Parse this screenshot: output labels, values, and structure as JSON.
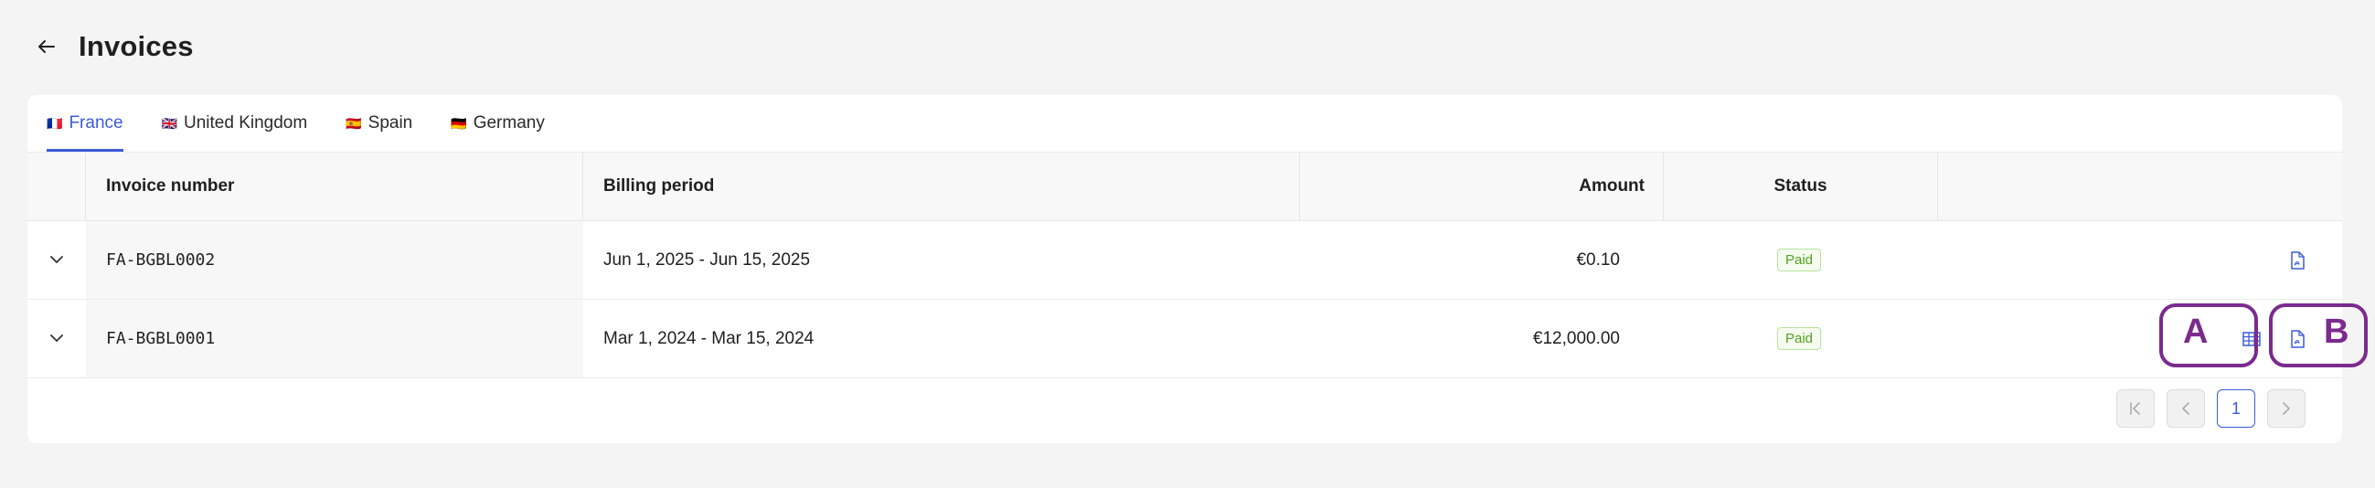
{
  "header": {
    "title": "Invoices"
  },
  "tabs": [
    {
      "flag": "🇫🇷",
      "label": "France"
    },
    {
      "flag": "🇬🇧",
      "label": "United Kingdom"
    },
    {
      "flag": "🇪🇸",
      "label": "Spain"
    },
    {
      "flag": "🇩🇪",
      "label": "Germany"
    }
  ],
  "table": {
    "columns": {
      "invoice_number": "Invoice number",
      "billing_period": "Billing period",
      "amount": "Amount",
      "status": "Status"
    },
    "rows": [
      {
        "invoice_number": "FA-BGBL0002",
        "billing_period": "Jun 1, 2025 - Jun 15, 2025",
        "amount": "€0.10",
        "status": "Paid"
      },
      {
        "invoice_number": "FA-BGBL0001",
        "billing_period": "Mar 1, 2024 - Mar 15, 2024",
        "amount": "€12,000.00",
        "status": "Paid"
      }
    ]
  },
  "pagination": {
    "current_page": "1"
  },
  "annotations": {
    "a_label": "A",
    "b_label": "B"
  },
  "colors": {
    "accent": "#3b5bdb",
    "paid_green": "#52a021",
    "annotation_purple": "#7b2a8d"
  }
}
